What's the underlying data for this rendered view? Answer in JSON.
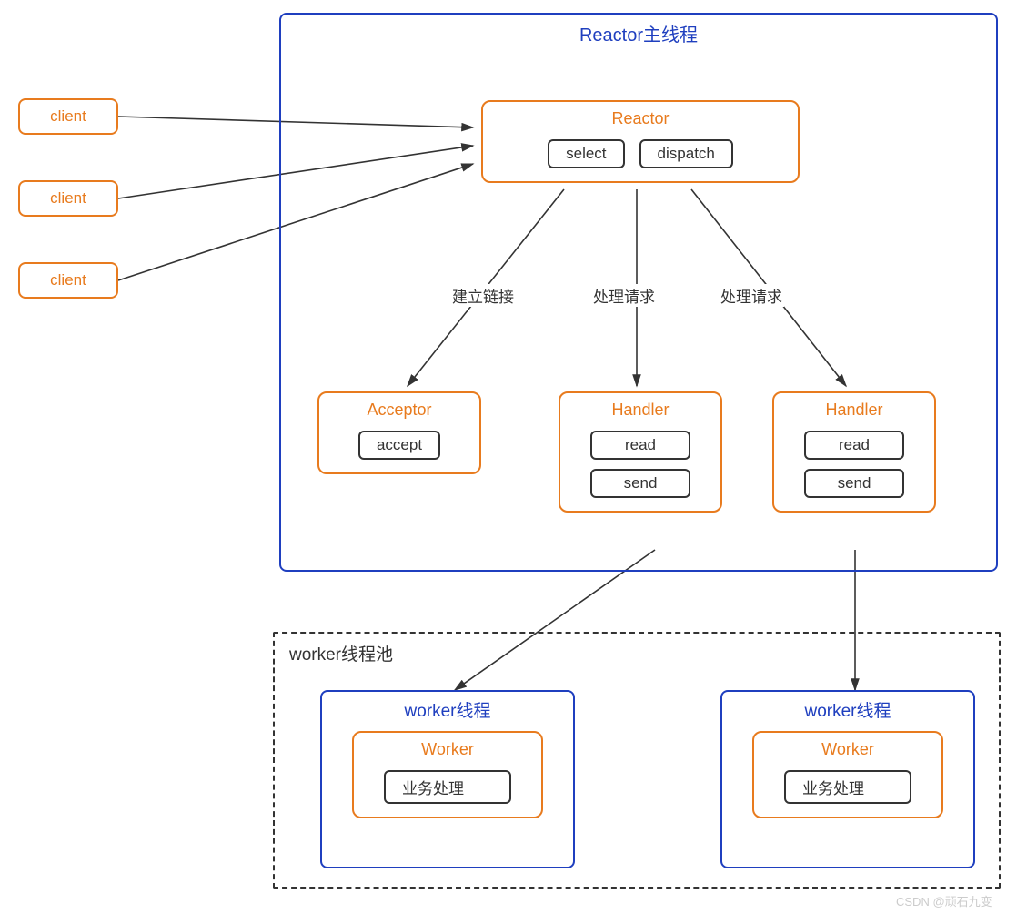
{
  "clients": [
    "client",
    "client",
    "client"
  ],
  "mainThread": {
    "title": "Reactor主线程",
    "reactor": {
      "title": "Reactor",
      "ops": [
        "select",
        "dispatch"
      ]
    },
    "acceptor": {
      "title": "Acceptor",
      "ops": [
        "accept"
      ]
    },
    "handlers": [
      {
        "title": "Handler",
        "ops": [
          "read",
          "send"
        ]
      },
      {
        "title": "Handler",
        "ops": [
          "read",
          "send"
        ]
      }
    ],
    "edgeLabels": {
      "establish": "建立链接",
      "process1": "处理请求",
      "process2": "处理请求"
    }
  },
  "pool": {
    "title": "worker线程池",
    "workers": [
      {
        "title": "worker线程",
        "inner": {
          "title": "Worker",
          "ops": [
            "业务处理"
          ]
        }
      },
      {
        "title": "worker线程",
        "inner": {
          "title": "Worker",
          "ops": [
            "业务处理"
          ]
        }
      }
    ]
  },
  "watermark": "CSDN @顽石九变"
}
